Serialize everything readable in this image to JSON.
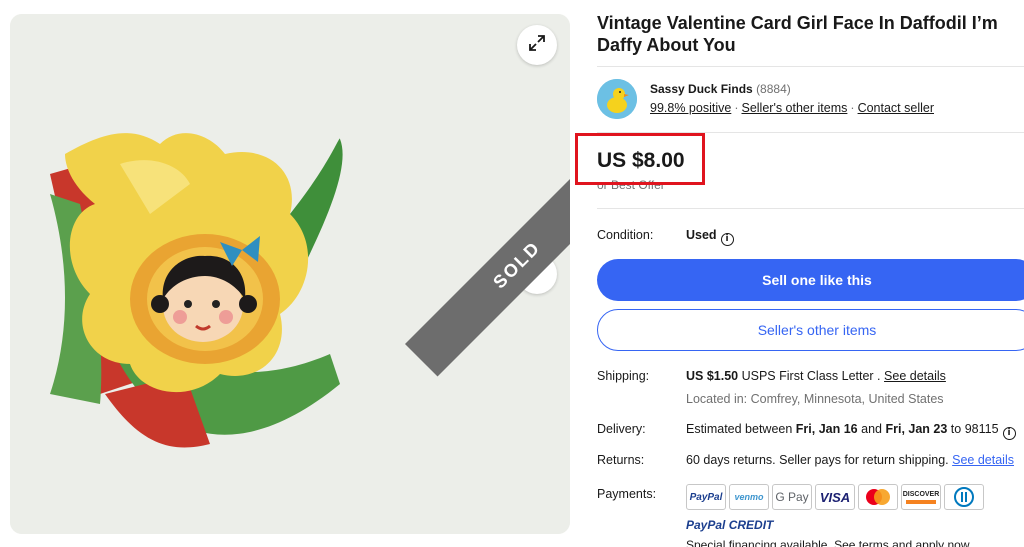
{
  "listing": {
    "title": "Vintage Valentine Card Girl Face In Daffodil I’m Daffy About You",
    "sold_badge": "SOLD"
  },
  "icons": {
    "expand": "expand-icon",
    "next": "chevron-right-icon",
    "info": "info-icon"
  },
  "seller": {
    "name": "Sassy Duck Finds",
    "feedback_count": "(8884)",
    "positive": "99.8% positive",
    "other_items": "Seller's other items",
    "contact": "Contact seller"
  },
  "price": {
    "value": "US $8.00",
    "best_offer": "or Best Offer",
    "highlight_color": "#e0141e"
  },
  "condition": {
    "label": "Condition:",
    "value": "Used"
  },
  "buttons": {
    "sell_one": "Sell one like this",
    "sellers_other_items": "Seller's other items",
    "primary_color": "#3665f3"
  },
  "shipping": {
    "label": "Shipping:",
    "amount": "US $1.50",
    "service": "USPS First Class Letter .",
    "see_details": "See details",
    "location": "Located in: Comfrey, Minnesota, United States"
  },
  "delivery": {
    "label": "Delivery:",
    "prefix": "Estimated between",
    "start": "Fri, Jan 16",
    "and": "and",
    "end": "Fri, Jan 23",
    "to": "to 98115"
  },
  "returns": {
    "label": "Returns:",
    "text": "60 days returns. Seller pays for return shipping.",
    "see_details": "See details"
  },
  "payments": {
    "label": "Payments:",
    "methods": [
      "PayPal",
      "venmo",
      "G Pay",
      "VISA",
      "Mastercard",
      "DISCOVER",
      "Diners Club"
    ],
    "paypal_credit": "PayPal CREDIT",
    "financing": "Special financing available. See terms and apply now"
  }
}
